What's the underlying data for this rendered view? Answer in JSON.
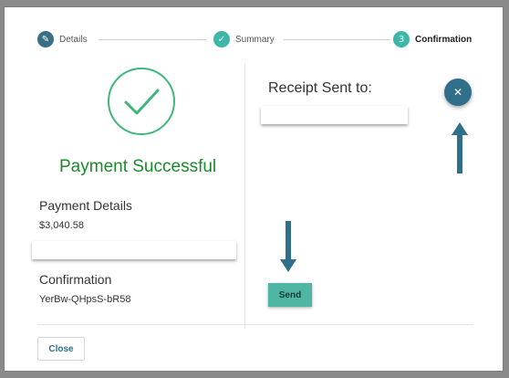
{
  "stepper": {
    "steps": [
      {
        "label": "Details",
        "status": "done",
        "icon": "pencil-icon"
      },
      {
        "label": "Summary",
        "status": "done",
        "icon": "check-icon"
      },
      {
        "label": "Confirmation",
        "status": "active",
        "number": "3"
      }
    ]
  },
  "success": {
    "title": "Payment Successful",
    "icon": "check-circle-icon"
  },
  "payment_details": {
    "label": "Payment Details",
    "amount": "$3,040.58"
  },
  "confirmation": {
    "label": "Confirmation",
    "code": "YerBw-QHpsS-bR58"
  },
  "receipt": {
    "title": "Receipt Sent to:",
    "email_value": ""
  },
  "buttons": {
    "send_label": "Send",
    "close_label": "Close",
    "close_fab_icon": "close-icon"
  },
  "colors": {
    "accent": "#3fb7a8",
    "success_green": "#1a8a2a",
    "dark_teal": "#2f6f8a"
  }
}
